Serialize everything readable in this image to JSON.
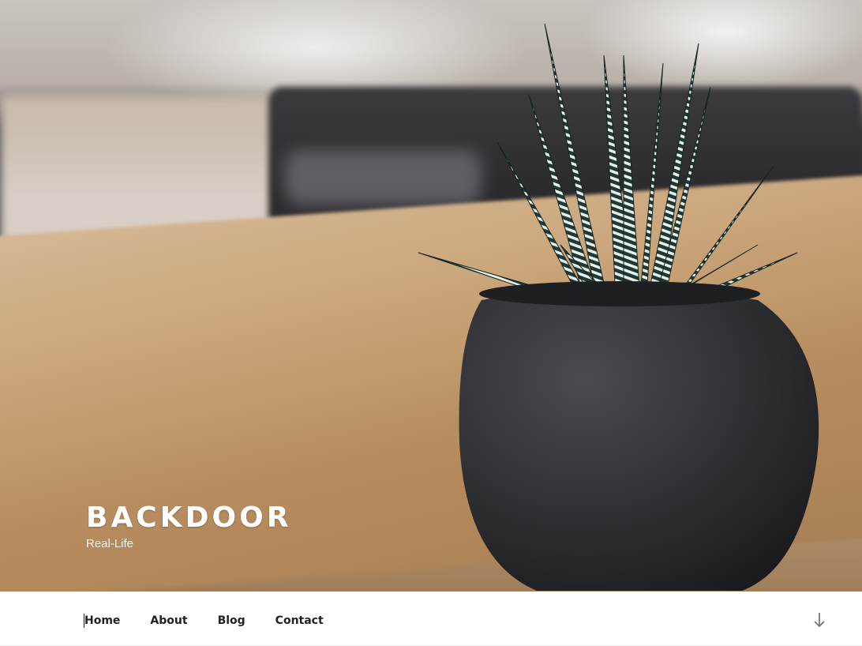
{
  "header": {
    "site_title": "BACKDOOR",
    "site_description": "Real-Life",
    "hero_image": "succulent-plant-in-dark-pot-on-wooden-table"
  },
  "nav": {
    "items": [
      {
        "label": "Home",
        "current": true
      },
      {
        "label": "About",
        "current": false
      },
      {
        "label": "Blog",
        "current": false
      },
      {
        "label": "Contact",
        "current": false
      }
    ],
    "scroll_icon": "arrow-down-icon"
  },
  "colors": {
    "title": "#ffffff",
    "nav_text": "#222222",
    "nav_bg": "#ffffff"
  }
}
